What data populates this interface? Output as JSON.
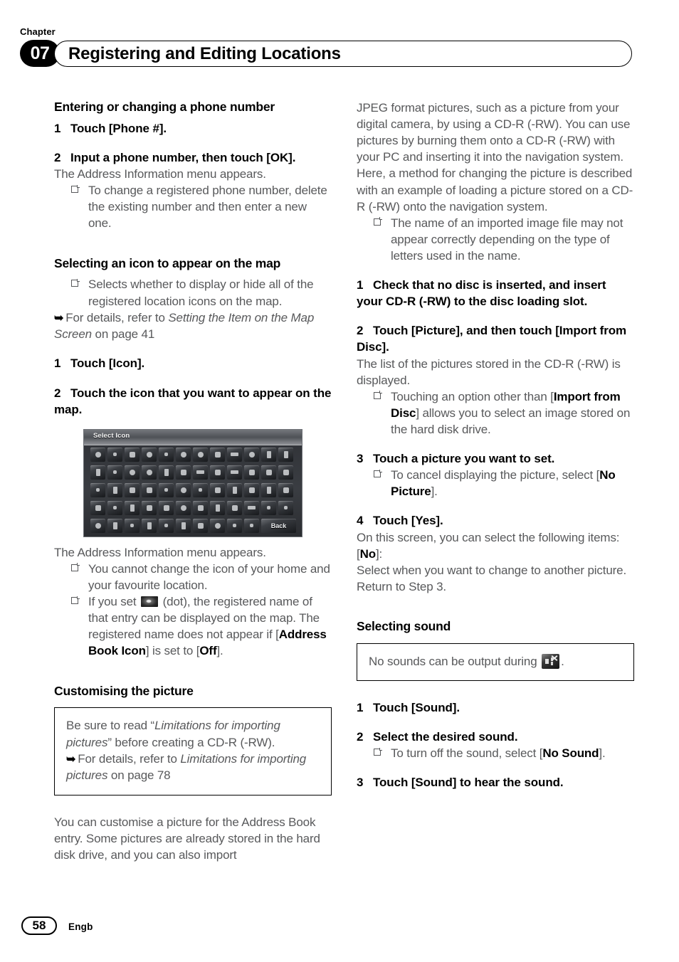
{
  "header": {
    "chapter_label": "Chapter",
    "chapter_number": "07",
    "title": "Registering and Editing Locations"
  },
  "footer": {
    "page_number": "58",
    "language_code": "Engb"
  },
  "left_column": {
    "section_phone_heading": "Entering or changing a phone number",
    "step1": {
      "num": "1",
      "text": "Touch [Phone #]."
    },
    "step2": {
      "num": "2",
      "text": "Input a phone number, then touch [OK]."
    },
    "step2_result": "The Address Information menu appears.",
    "step2_bullet": "To change a registered phone number, delete the existing number and then enter a new one.",
    "section_icon_heading": "Selecting an icon to appear on the map",
    "icon_bullet": "Selects whether to display or hide all of the registered location icons on the map.",
    "icon_ref_prefix": "For details, refer to ",
    "icon_ref_italic": "Setting the Item on the Map Screen",
    "icon_ref_suffix": " on page 41",
    "icon_step1": {
      "num": "1",
      "text": "Touch [Icon]."
    },
    "icon_step2": {
      "num": "2",
      "text": "Touch the icon that you want to appear on the map."
    },
    "screenshot": {
      "title": "Select Icon",
      "back_label": "Back",
      "row_tile_counts": [
        12,
        12,
        12,
        12,
        10
      ]
    },
    "icon_result": "The Address Information menu appears.",
    "icon_bullet2": "You cannot change the icon of your home and your favourite location.",
    "icon_bullet3_a": "If you set ",
    "icon_bullet3_b": " (dot), the registered name of that entry can be displayed on the map. The registered name does not appear if [",
    "icon_bullet3_bold1": "Address Book Icon",
    "icon_bullet3_c": "] is set to [",
    "icon_bullet3_bold2": "Off",
    "icon_bullet3_d": "].",
    "section_picture_heading": "Customising the picture",
    "picture_note_a": "Be sure to read “",
    "picture_note_italic1": "Limitations for importing pictures",
    "picture_note_b": "” before creating a CD-R (-RW).",
    "picture_note_ref_prefix": "For details, refer to ",
    "picture_note_ref_italic": "Limitations for importing pictures",
    "picture_note_ref_suffix": " on page 78",
    "picture_body": "You can customise a picture for the Address Book entry. Some pictures are already stored in the hard disk drive, and you can also import"
  },
  "right_column": {
    "intro_para1": "JPEG format pictures, such as a picture from your digital camera, by using a CD-R (-RW). You can use pictures by burning them onto a CD-R (-RW) with your PC and inserting it into the navigation system.",
    "intro_para2": "Here, a method for changing the picture is described with an example of loading a picture stored on a CD-R (-RW) onto the navigation system.",
    "intro_bullet": "The name of an imported image file may not appear correctly depending on the type of letters used in the name.",
    "step1": {
      "num": "1",
      "text": "Check that no disc is inserted, and insert your CD-R (-RW) to the disc loading slot."
    },
    "step2": {
      "num": "2",
      "text": "Touch [Picture], and then touch [Import from Disc]."
    },
    "step2_result": "The list of the pictures stored in the CD-R (-RW) is displayed.",
    "step2_bullet_a": "Touching an option other than [",
    "step2_bullet_bold": "Import from Disc",
    "step2_bullet_b": "] allows you to select an image stored on the hard disk drive.",
    "step3": {
      "num": "3",
      "text": "Touch a picture you want to set."
    },
    "step3_bullet_a": "To cancel displaying the picture, select [",
    "step3_bullet_bold": "No Picture",
    "step3_bullet_b": "].",
    "step4": {
      "num": "4",
      "text": "Touch [Yes]."
    },
    "step4_result1": "On this screen, you can select the following items:",
    "step4_no_label_a": "[",
    "step4_no_bold": "No",
    "step4_no_label_b": "]:",
    "step4_result2": "Select when you want to change to another picture.",
    "step4_result3": "Return to Step 3.",
    "section_sound_heading": "Selecting sound",
    "sound_note_a": "No sounds can be output during ",
    "sound_note_b": ".",
    "sound_step1": {
      "num": "1",
      "text": "Touch [Sound]."
    },
    "sound_step2": {
      "num": "2",
      "text": "Select the desired sound."
    },
    "sound_step2_bullet_a": "To turn off the sound, select [",
    "sound_step2_bullet_bold": "No Sound",
    "sound_step2_bullet_b": "].",
    "sound_step3": {
      "num": "3",
      "text": "Touch [Sound] to hear the sound."
    }
  }
}
